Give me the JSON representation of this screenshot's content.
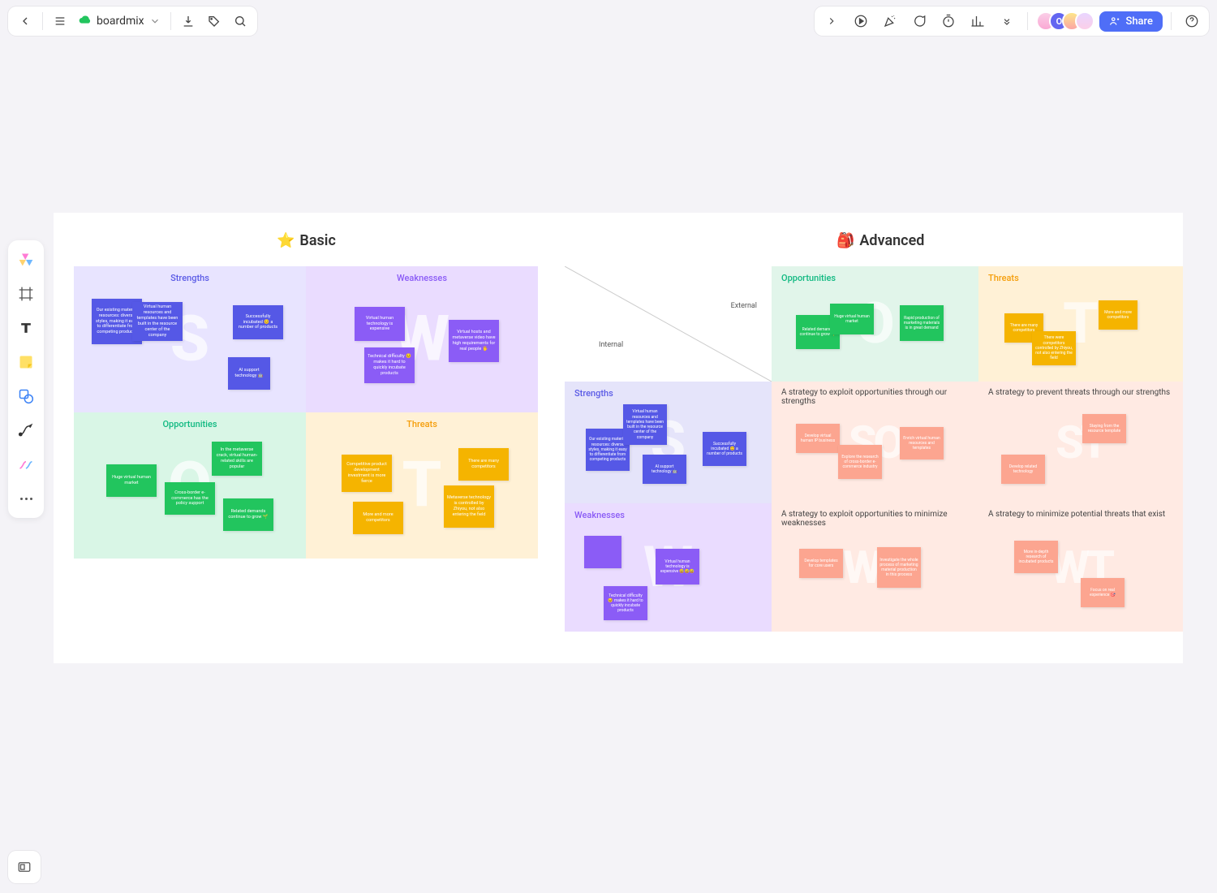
{
  "header": {
    "app_name": "boardmix",
    "share_label": "Share",
    "avatar_letter": "O"
  },
  "titles": {
    "basic": "Basic",
    "advanced": "Advanced"
  },
  "basic": {
    "s": {
      "title": "Strengths",
      "letter": "S"
    },
    "w": {
      "title": "Weaknesses",
      "letter": "W"
    },
    "o": {
      "title": "Opportunities",
      "letter": "O"
    },
    "t": {
      "title": "Threats",
      "letter": "T"
    },
    "notes": {
      "s1": "Our existing material resources: diverse styles, making it easy to differentiate from competing products",
      "s2": "Virtual human resources and templates have been built in the resource center of the company",
      "s3": "Successfully incubated 😊 a number of products",
      "s4": "AI support technology 🤖",
      "w1": "Virtual human technology is expensive",
      "w2": "Technical difficulty 😣 makes it hard to quickly incubate products",
      "w3": "Virtual hosts and metaverse video have high requirements for real people 🖐️",
      "o1": "Huge virtual human market",
      "o2": "In the metaverse crack, virtual human-related skills are popular",
      "o3": "Cross-border e-commerce has the policy support",
      "o4": "Related demands continue to grow 🌱",
      "t1": "Competitive product development investment is more fierce",
      "t2": "More and more competitors",
      "t3": "There are many competitors",
      "t4": "Metaverse technology is controlled by Zhiyou, not also entering the field"
    }
  },
  "advanced": {
    "labels": {
      "internal": "Internal",
      "external": "External"
    },
    "opp": {
      "title": "Opportunities",
      "letter": "O"
    },
    "thr": {
      "title": "Threats",
      "letter": "T"
    },
    "str": {
      "title": "Strengths",
      "letter": "S"
    },
    "weak": {
      "title": "Weaknesses",
      "letter": "W"
    },
    "so": {
      "strategy": "A strategy to exploit opportunities through our strengths",
      "letter": "SO"
    },
    "st": {
      "strategy": "A strategy to prevent threats through our strengths",
      "letter": "ST"
    },
    "wo": {
      "strategy": "A strategy to exploit opportunities to minimize weaknesses",
      "letter": "WO"
    },
    "wt": {
      "strategy": "A strategy to minimize potential threats that exist",
      "letter": "WT"
    },
    "notes": {
      "o1": "Related demands continue to grow 🌱",
      "o2": "Huge virtual human market",
      "o3": "Rapid production of marketing materials is in great demand",
      "t1": "There are many competitors",
      "t2": "More and more competitors",
      "t3": "There were competitors controlled by Zhiyou, not also entering the field",
      "s1": "Our existing material resources: diverse styles, making it easy to differentiate from competing products",
      "s2": "Virtual human resources and templates have been built in the resource center of the company",
      "s3": "AI support technology 🤖",
      "s4": "Successfully incubated 😊 a number of products",
      "w1": "",
      "w2": "Virtual human technology is expensive 😅😅😅",
      "w3": "Technical difficulty 😣 makes it hard to quickly incubate products",
      "so1": "Develop virtual human IP business",
      "so2": "Explore the research of cross-border e-commerce industry",
      "so3": "Enrich virtual human resources and templates",
      "st1": "Staying from the resource template",
      "st2": "Develop related technology",
      "wo1": "Develop templates for core users",
      "wo2": "Investigate the whole process of marketing material production in this process",
      "wt1": "More in-depth research of incubated products",
      "wt2": "Focus on real experience 🎯"
    }
  }
}
